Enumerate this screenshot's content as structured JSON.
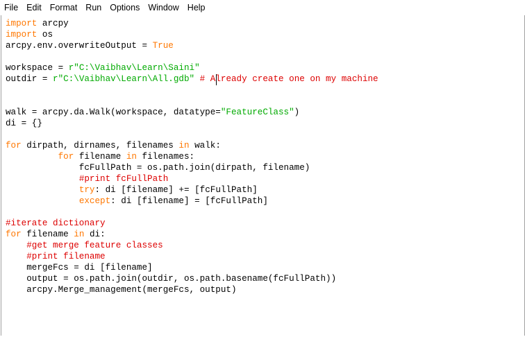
{
  "menu": [
    "File",
    "Edit",
    "Format",
    "Run",
    "Options",
    "Window",
    "Help"
  ],
  "colors": {
    "keyword": "#ff7700",
    "string": "#00aa00",
    "comment": "#dd0000",
    "builtin": "#900090",
    "text": "#000000"
  },
  "code_lines": [
    [
      [
        "kw",
        "import"
      ],
      [
        "tx",
        " arcpy"
      ]
    ],
    [
      [
        "kw",
        "import"
      ],
      [
        "tx",
        " os"
      ]
    ],
    [
      [
        "tx",
        "arcpy.env.overwriteOutput = "
      ],
      [
        "kw",
        "True"
      ]
    ],
    [],
    [
      [
        "tx",
        "workspace = "
      ],
      [
        "str",
        "r\"C:\\Vaibhav\\Learn\\Saini\""
      ]
    ],
    [
      [
        "tx",
        "outdir = "
      ],
      [
        "str",
        "r\"C:\\Vaibhav\\Learn\\All.gdb\""
      ],
      [
        "tx",
        " "
      ],
      [
        "cm",
        "# Already create one on my machine"
      ]
    ],
    [],
    [],
    [
      [
        "tx",
        "walk = arcpy.da.Walk(workspace, datatype="
      ],
      [
        "str",
        "\"FeatureClass\""
      ],
      [
        "tx",
        ")"
      ]
    ],
    [
      [
        "tx",
        "di = {}"
      ]
    ],
    [],
    [
      [
        "kw",
        "for"
      ],
      [
        "tx",
        " dirpath, dirnames, filenames "
      ],
      [
        "kw",
        "in"
      ],
      [
        "tx",
        " walk:"
      ]
    ],
    [
      [
        "tx",
        "          "
      ],
      [
        "kw",
        "for"
      ],
      [
        "tx",
        " filename "
      ],
      [
        "kw",
        "in"
      ],
      [
        "tx",
        " filenames:"
      ]
    ],
    [
      [
        "tx",
        "              fcFullPath = os.path.join(dirpath, filename)"
      ]
    ],
    [
      [
        "tx",
        "              "
      ],
      [
        "cm",
        "#print fcFullPath"
      ]
    ],
    [
      [
        "tx",
        "              "
      ],
      [
        "kw",
        "try"
      ],
      [
        "tx",
        ": di [filename] += [fcFullPath]"
      ]
    ],
    [
      [
        "tx",
        "              "
      ],
      [
        "kw",
        "except"
      ],
      [
        "tx",
        ": di [filename] = [fcFullPath]"
      ]
    ],
    [],
    [
      [
        "cm",
        "#iterate dictionary"
      ]
    ],
    [
      [
        "kw",
        "for"
      ],
      [
        "tx",
        " filename "
      ],
      [
        "kw",
        "in"
      ],
      [
        "tx",
        " di:"
      ]
    ],
    [
      [
        "tx",
        "    "
      ],
      [
        "cm",
        "#get merge feature classes"
      ]
    ],
    [
      [
        "tx",
        "    "
      ],
      [
        "cm",
        "#print filename"
      ]
    ],
    [
      [
        "tx",
        "    mergeFcs = di [filename]"
      ]
    ],
    [
      [
        "tx",
        "    output = os.path.join(outdir, os.path.basename(fcFullPath))"
      ]
    ],
    [
      [
        "tx",
        "    arcpy.Merge_management(mergeFcs, output)"
      ]
    ]
  ]
}
